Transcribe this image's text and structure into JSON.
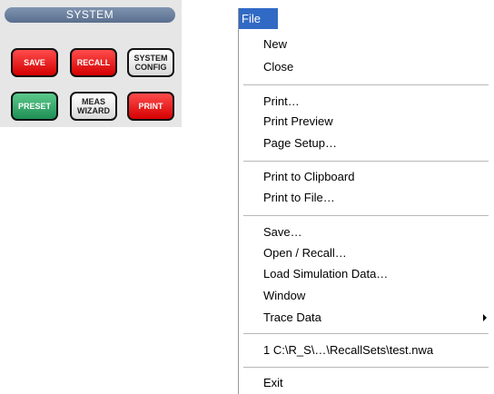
{
  "system_panel": {
    "title": "SYSTEM",
    "keys": {
      "save": "SAVE",
      "recall": "RECALL",
      "system_config": "SYSTEM\nCONFIG",
      "preset": "PRESET",
      "meas_wizard": "MEAS\nWIZARD",
      "print": "PRINT"
    }
  },
  "menu": {
    "title": "File",
    "items": {
      "new": "New",
      "close": "Close",
      "print": "Print…",
      "print_preview": "Print Preview",
      "page_setup": "Page Setup…",
      "print_clipboard": "Print to Clipboard",
      "print_file": "Print to File…",
      "save": "Save…",
      "open_recall": "Open / Recall…",
      "load_sim": "Load Simulation Data…",
      "window": "Window",
      "trace_data": "Trace Data",
      "recent_1": "1 C:\\R_S\\…\\RecallSets\\test.nwa",
      "exit": "Exit"
    }
  },
  "colors": {
    "menubar_highlight": "#316ac5",
    "key_red": "#e81010",
    "key_green": "#2fa866",
    "panel_title": "#6c819f"
  }
}
